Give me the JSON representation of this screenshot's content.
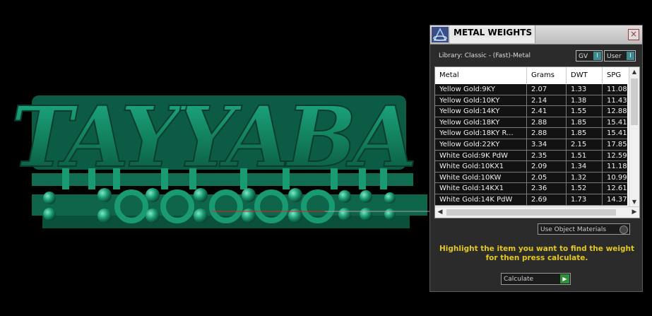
{
  "viewport": {
    "ring_text": "TAYYABA"
  },
  "panel": {
    "title": "METAL WEIGHTS",
    "close": "×",
    "library": "Library: Classic - (Fast)-Metal",
    "gv_label": "GV",
    "user_label": "User",
    "toggle_mark": "I",
    "columns": [
      "Metal",
      "Grams",
      "DWT",
      "SPG"
    ],
    "rows": [
      [
        "Yellow Gold:9KY",
        "2.07",
        "1.33",
        "11.08"
      ],
      [
        "Yellow Gold:10KY",
        "2.14",
        "1.38",
        "11.43"
      ],
      [
        "Yellow Gold:14KY",
        "2.41",
        "1.55",
        "12.88"
      ],
      [
        "Yellow Gold:18KY",
        "2.88",
        "1.85",
        "15.41"
      ],
      [
        "Yellow Gold:18KY R...",
        "2.88",
        "1.85",
        "15.41"
      ],
      [
        "Yellow Gold:22KY",
        "3.34",
        "2.15",
        "17.85"
      ],
      [
        "White Gold:9K PdW",
        "2.35",
        "1.51",
        "12.59"
      ],
      [
        "White Gold:10KX1",
        "2.09",
        "1.34",
        "11.18"
      ],
      [
        "White Gold:10KW",
        "2.05",
        "1.32",
        "10.99"
      ],
      [
        "White Gold:14KX1",
        "2.36",
        "1.52",
        "12.61"
      ],
      [
        "White Gold:14K PdW",
        "2.69",
        "1.73",
        "14.37"
      ]
    ],
    "use_object_materials": "Use Object Materials",
    "instruction": "Highlight the item you want to find the weight for then press calculate.",
    "calculate": "Calculate",
    "scroll_left": "◀",
    "scroll_right": "▶",
    "scroll_up": "▲",
    "scroll_down": "▼",
    "go_arrow": "▶"
  }
}
